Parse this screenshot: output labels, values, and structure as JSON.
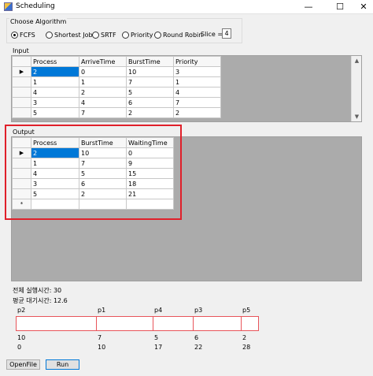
{
  "window": {
    "title": "Scheduling",
    "min_icon": "minimize-icon",
    "max_icon": "maximize-icon",
    "close_icon": "close-icon"
  },
  "algorithm": {
    "legend": "Choose Algorithm",
    "options": [
      "FCFS",
      "Shortest Job",
      "SRTF",
      "Priority",
      "Round Robin"
    ],
    "selected": "FCFS",
    "slice_label": "Slice =",
    "slice_value": "4"
  },
  "input": {
    "label": "Input",
    "columns": [
      "Process",
      "ArriveTime",
      "BurstTime",
      "Priority"
    ],
    "rows": [
      [
        "2",
        "0",
        "10",
        "3"
      ],
      [
        "1",
        "1",
        "7",
        "1"
      ],
      [
        "4",
        "2",
        "5",
        "4"
      ],
      [
        "3",
        "4",
        "6",
        "7"
      ],
      [
        "5",
        "7",
        "2",
        "2"
      ]
    ]
  },
  "output": {
    "label": "Output",
    "columns": [
      "Process",
      "BurstTime",
      "WaitingTime"
    ],
    "rows": [
      [
        "2",
        "10",
        "0"
      ],
      [
        "1",
        "7",
        "9"
      ],
      [
        "4",
        "5",
        "15"
      ],
      [
        "3",
        "6",
        "18"
      ],
      [
        "5",
        "2",
        "21"
      ]
    ],
    "new_row_marker": "*"
  },
  "summary": {
    "total_time": "전체 실행시간: 30",
    "avg_wait": "평균 대기시간: 12.6"
  },
  "gantt": {
    "processes": [
      "p2",
      "p1",
      "p4",
      "p3",
      "p5"
    ],
    "bursts": [
      "10",
      "7",
      "5",
      "6",
      "2"
    ],
    "starts": [
      "0",
      "10",
      "17",
      "22",
      "28"
    ],
    "border_color": "#e8545a"
  },
  "buttons": {
    "open": "OpenFile",
    "run": "Run"
  },
  "highlight_color": "#e0202a",
  "selection_color": "#0078d7"
}
